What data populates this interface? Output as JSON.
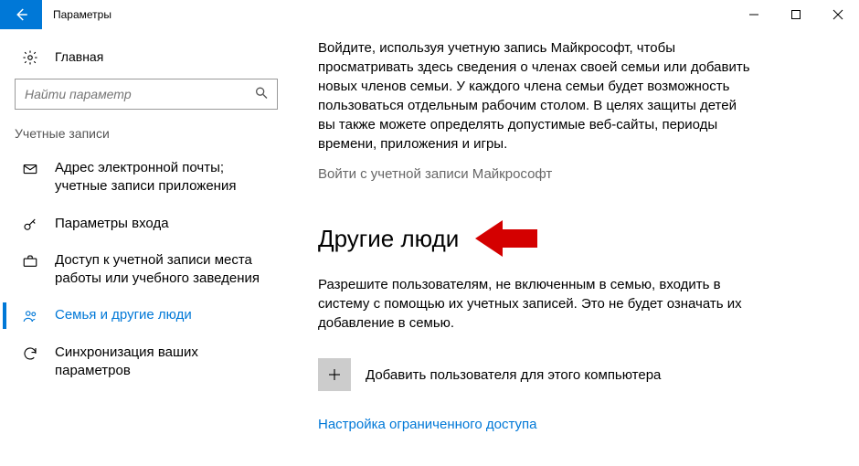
{
  "titlebar": {
    "title": "Параметры"
  },
  "sidebar": {
    "home_label": "Главная",
    "search_placeholder": "Найти параметр",
    "section_label": "Учетные записи",
    "items": [
      {
        "label": "Адрес электронной почты; учетные записи приложения"
      },
      {
        "label": "Параметры входа"
      },
      {
        "label": "Доступ к учетной записи места работы или учебного заведения"
      },
      {
        "label": "Семья и другие люди"
      },
      {
        "label": "Синхронизация ваших параметров"
      }
    ]
  },
  "content": {
    "intro": "Войдите, используя учетную запись Майкрософт, чтобы просматривать здесь сведения о членах своей семьи или добавить новых членов семьи. У каждого члена семьи будет возможность пользоваться отдельным рабочим столом. В целях защиты детей вы также можете определять допустимые веб-сайты, периоды времени, приложения и игры.",
    "signin_link": "Войти с учетной записи Майкрософт",
    "other_people_heading": "Другие люди",
    "other_people_desc": "Разрешите пользователям, не включенным в семью, входить в систему с помощью их учетных записей. Это не будет означать их добавление в семью.",
    "add_user_label": "Добавить пользователя для этого компьютера",
    "limited_link": "Настройка ограниченного доступа"
  },
  "colors": {
    "accent": "#0078d7",
    "link": "#0078d7",
    "arrow": "#d40000"
  }
}
